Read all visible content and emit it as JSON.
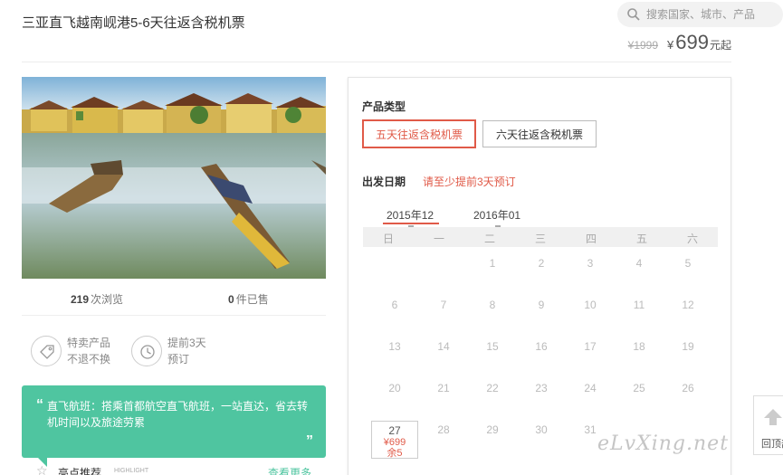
{
  "header": {
    "title": "三亚直飞越南岘港5-6天往返含税机票",
    "search_placeholder": "搜索国家、城市、产品",
    "old_price": "¥1999",
    "currency": "¥",
    "price": "699",
    "price_unit": "元起"
  },
  "stats": {
    "views_count": "219",
    "views_label": "次浏览",
    "sold_count": "0",
    "sold_label": "件已售"
  },
  "features": [
    {
      "line1": "特卖产品",
      "line2": "不退不换",
      "icon": "tag-icon"
    },
    {
      "line1": "提前3天",
      "line2": "预订",
      "icon": "clock-icon"
    }
  ],
  "highlight": {
    "open_quote": "“",
    "text": "直飞航班：搭乘首都航空直飞航班，一站直达，省去转机时间以及旅途劳累",
    "close_quote": "”"
  },
  "recommend": {
    "title": "亮点推荐",
    "subtitle": "HIGHLIGHT",
    "more": "查看更多"
  },
  "booking": {
    "type_label": "产品类型",
    "types": [
      "五天往返含税机票",
      "六天往返含税机票"
    ],
    "date_label": "出发日期",
    "date_hint": "请至少提前3天预订",
    "months": [
      "2015年12",
      "2016年01"
    ],
    "weekdays": [
      "日",
      "一",
      "二",
      "三",
      "四",
      "五",
      "六"
    ],
    "days": [
      "1",
      "2",
      "3",
      "4",
      "5",
      "6",
      "7",
      "8",
      "9",
      "10",
      "11",
      "12",
      "13",
      "14",
      "15",
      "16",
      "17",
      "18",
      "19",
      "20",
      "21",
      "22",
      "23",
      "24",
      "25",
      "26",
      "27",
      "28",
      "29",
      "30",
      "31"
    ],
    "selected_day": {
      "day": "27",
      "price": "¥699",
      "stock": "余5"
    }
  },
  "side": {
    "label": "回顶部"
  },
  "watermark": "eLvXing.net",
  "colors": {
    "accent": "#e05a48",
    "green": "#4fc5a0"
  }
}
